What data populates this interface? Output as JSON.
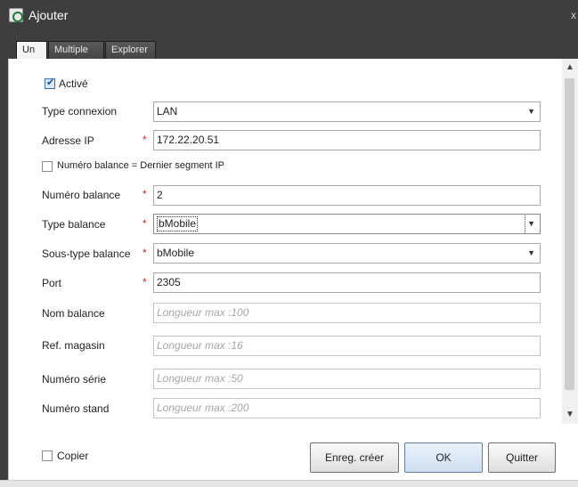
{
  "window": {
    "title": "Ajouter",
    "close_glyph": "x"
  },
  "tabs": [
    {
      "label": "Un",
      "active": true
    },
    {
      "label": "Multiple",
      "active": false
    },
    {
      "label": "Explorer",
      "active": false
    }
  ],
  "form": {
    "active": {
      "label": "Activé",
      "checked": true
    },
    "connection_type": {
      "label": "Type connexion",
      "value": "LAN"
    },
    "ip_address": {
      "label": "Adresse IP",
      "value": "172.22.20.51",
      "required_mark": "*"
    },
    "balance_number_from_ip": {
      "label": "Numéro balance = Dernier segment IP",
      "checked": false
    },
    "balance_number": {
      "label": "Numéro balance",
      "value": "2",
      "required_mark": "*"
    },
    "balance_type": {
      "label": "Type balance",
      "value": "bMobile",
      "required_mark": "*"
    },
    "balance_subtype": {
      "label": "Sous-type balance",
      "value": "bMobile",
      "required_mark": "*"
    },
    "port": {
      "label": "Port",
      "value": "2305",
      "required_mark": "*"
    },
    "balance_name": {
      "label": "Nom balance",
      "placeholder": "Longueur max :100"
    },
    "store_ref": {
      "label": "Ref. magasin",
      "placeholder": "Longueur max :16"
    },
    "serial_number": {
      "label": "Numéro série",
      "placeholder": "Longueur max :50"
    },
    "stand_number": {
      "label": "Numéro stand",
      "placeholder": "Longueur max :200"
    }
  },
  "footer": {
    "copy": {
      "label": "Copier",
      "checked": false
    },
    "save_create_label": "Enreg. créer",
    "ok_label": "OK",
    "quit_label": "Quitter"
  },
  "colors": {
    "titlebar": "#3e3e3e",
    "required": "#dd2222",
    "placeholder": "#a6a6a6"
  },
  "icons": [
    "app-icon",
    "close-icon",
    "chevron-down-icon",
    "scroll-up-icon",
    "scroll-down-icon",
    "check-icon"
  ]
}
